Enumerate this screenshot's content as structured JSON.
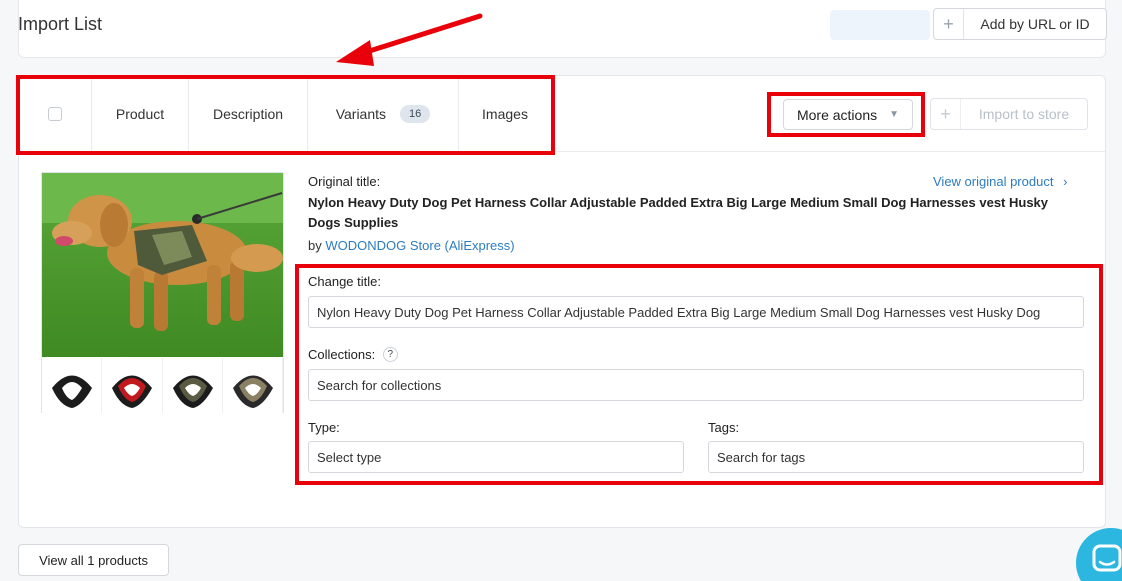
{
  "header": {
    "title": "Import List",
    "add_by_url_label": "Add by URL or ID"
  },
  "tabs": {
    "product": "Product",
    "description": "Description",
    "variants": "Variants",
    "variants_count": "16",
    "images": "Images"
  },
  "actions": {
    "more_actions": "More actions",
    "import_to_store": "Import to store"
  },
  "product": {
    "original_title_label": "Original title:",
    "original_title": "Nylon Heavy Duty Dog Pet Harness Collar Adjustable Padded Extra Big Large Medium Small Dog Harnesses vest Husky Dogs Supplies",
    "by_prefix": "by",
    "store_name": "WODONDOG Store (AliExpress)",
    "view_original": "View original product"
  },
  "form": {
    "change_title_label": "Change title:",
    "title_value": "Nylon Heavy Duty Dog Pet Harness Collar Adjustable Padded Extra Big Large Medium Small Dog Harnesses vest Husky Dog",
    "collections_label": "Collections:",
    "collections_placeholder": "Search for collections",
    "type_label": "Type:",
    "type_placeholder": "Select type",
    "tags_label": "Tags:",
    "tags_placeholder": "Search for tags"
  },
  "footer": {
    "view_all": "View all 1 products"
  },
  "colors": {
    "highlight": "#e8000b",
    "link": "#2d7cc1",
    "chat": "#2bb7e0"
  }
}
